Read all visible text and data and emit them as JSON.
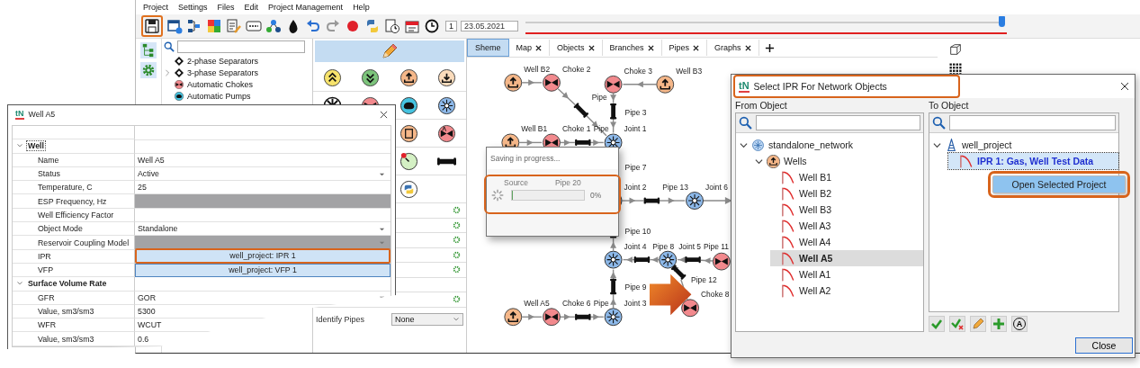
{
  "menu": [
    "Project",
    "Settings",
    "Files",
    "Edit",
    "Project Management",
    "Help"
  ],
  "toolbar": {
    "save_highlighted": true,
    "step": "1",
    "date": "23.05.2021",
    "timeline": {
      "level": 1
    }
  },
  "object_tree": {
    "items": [
      {
        "label": "2-phase Separators",
        "kind": "separator",
        "expandable": false
      },
      {
        "label": "3-phase Separators",
        "kind": "separator",
        "expandable": true
      },
      {
        "label": "Automatic Chokes",
        "kind": "choke",
        "expandable": false
      },
      {
        "label": "Automatic Pumps",
        "kind": "pump",
        "expandable": false
      }
    ]
  },
  "palette": {
    "identify_pipes": {
      "label": "Identify Pipes",
      "value": "None"
    }
  },
  "tabs": [
    {
      "label": "Sheme",
      "selected": true,
      "closable": false
    },
    {
      "label": "Map",
      "selected": false,
      "closable": true
    },
    {
      "label": "Objects",
      "selected": false,
      "closable": true
    },
    {
      "label": "Branches",
      "selected": false,
      "closable": true
    },
    {
      "label": "Pipes",
      "selected": false,
      "closable": true
    },
    {
      "label": "Graphs",
      "selected": false,
      "closable": true
    }
  ],
  "network": {
    "nodes": [
      {
        "kind": "well",
        "label": "Well B2"
      },
      {
        "kind": "choke",
        "label": "Choke 2"
      },
      {
        "kind": "choke",
        "label": "Choke 3"
      },
      {
        "kind": "well",
        "label": "Well B3"
      },
      {
        "kind": "pipe",
        "label": "Pipe"
      },
      {
        "kind": "pipe",
        "label": "Pipe 3"
      },
      {
        "kind": "well",
        "label": "Well B1"
      },
      {
        "kind": "choke",
        "label": "Choke 1"
      },
      {
        "kind": "pipe",
        "label": "Pipe"
      },
      {
        "kind": "joint",
        "label": "Joint 1"
      },
      {
        "kind": "pipe",
        "label": "Pipe 7"
      },
      {
        "kind": "joint",
        "label": "Joint 2"
      },
      {
        "kind": "pipe",
        "label": "Pipe 13"
      },
      {
        "kind": "joint",
        "label": "Joint 6"
      },
      {
        "kind": "pipe",
        "label": "Pipe 10"
      },
      {
        "kind": "joint",
        "label": "Joint 4"
      },
      {
        "kind": "pipe",
        "label": "Pipe 8"
      },
      {
        "kind": "joint",
        "label": "Joint 5"
      },
      {
        "kind": "pipe",
        "label": "Pipe 11"
      },
      {
        "kind": "choke"
      },
      {
        "kind": "pipe",
        "label": "Pipe 12"
      },
      {
        "kind": "pipe",
        "label": "Pipe 9"
      },
      {
        "kind": "well",
        "label": "Well A5"
      },
      {
        "kind": "choke",
        "label": "Choke 6"
      },
      {
        "kind": "pipe",
        "label": "Pipe"
      },
      {
        "kind": "joint",
        "label": "Joint 3"
      },
      {
        "kind": "choke",
        "label": "Choke 8"
      }
    ]
  },
  "saving_popup": {
    "title": "Saving in progress...",
    "source_label": "Source",
    "pipe_label": "Pipe 20",
    "percent": "0%",
    "level": 0,
    "highlighted": true
  },
  "well_window": {
    "logo": "tN",
    "title": "Well A5",
    "sections": [
      {
        "title": "Well",
        "expanded": true,
        "focused": true,
        "rows": [
          {
            "name": "Name",
            "value": "Well A5",
            "kind": "text",
            "highlighted": false
          },
          {
            "name": "Status",
            "value": "Active",
            "kind": "dropdown",
            "highlighted": false
          },
          {
            "name": "Temperature, C",
            "value": "25",
            "kind": "text",
            "highlighted": false
          },
          {
            "name": "ESP Frequency, Hz",
            "kind": "disabled",
            "highlighted": false
          },
          {
            "name": "Well Efficiency Factor",
            "kind": "text",
            "highlighted": false
          },
          {
            "name": "Object Mode",
            "value": "Standalone",
            "kind": "dropdown",
            "highlighted": false
          },
          {
            "name": "Reservoir Coupling Model",
            "kind": "disabled_dropdown",
            "highlighted": false
          },
          {
            "name": "IPR",
            "value": "well_project: IPR 1",
            "kind": "link",
            "highlighted": true
          },
          {
            "name": "VFP",
            "value": "well_project: VFP 1",
            "kind": "link",
            "highlighted": false
          }
        ]
      },
      {
        "title": "Surface Volume Rate",
        "expanded": true,
        "focused": false,
        "rows": [
          {
            "name": "GFR",
            "value": "GOR",
            "kind": "dropdown",
            "highlighted": false
          },
          {
            "name": "Value, sm3/sm3",
            "value": "5300",
            "kind": "text",
            "highlighted": false
          },
          {
            "name": "WFR",
            "value": "WCUT",
            "kind": "text",
            "highlighted": false
          },
          {
            "name": "Value, sm3/sm3",
            "value": "0.6",
            "kind": "text",
            "highlighted": false
          }
        ]
      }
    ]
  },
  "ipr_dialog": {
    "logo": "tN",
    "title": "Select IPR For Network Objects",
    "title_highlighted": true,
    "from_tree": {
      "label": "From Object",
      "focused": false,
      "nodes": [
        {
          "label": "standalone_network",
          "kind": "network",
          "expanded": true,
          "selected": false,
          "children": [
            {
              "label": "Wells",
              "kind": "group",
              "expanded": true,
              "selected": false,
              "children": [
                {
                  "label": "Well B1",
                  "kind": "curve",
                  "selected": false
                },
                {
                  "label": "Well B2",
                  "kind": "curve",
                  "selected": false
                },
                {
                  "label": "Well B3",
                  "kind": "curve",
                  "selected": false
                },
                {
                  "label": "Well A3",
                  "kind": "curve",
                  "selected": false
                },
                {
                  "label": "Well A4",
                  "kind": "curve",
                  "selected": false
                },
                {
                  "label": "Well A5",
                  "kind": "curve",
                  "selected": true
                },
                {
                  "label": "Well A1",
                  "kind": "curve",
                  "selected": false
                },
                {
                  "label": "Well A2",
                  "kind": "curve",
                  "selected": false
                }
              ]
            }
          ]
        }
      ]
    },
    "to_tree": {
      "label": "To Object",
      "focused": true,
      "nodes": [
        {
          "label": "well_project",
          "kind": "project",
          "expanded": true,
          "selected": false,
          "children": [
            {
              "label": "IPR 1: Gas, Well Test Data",
              "kind": "curve",
              "selected": true
            }
          ]
        }
      ]
    },
    "context_menu": [
      {
        "label": "Open Selected Project",
        "highlighted": true
      }
    ],
    "tool_buttons": [
      {
        "kind": "apply"
      },
      {
        "kind": "clear"
      },
      {
        "kind": "edit"
      },
      {
        "kind": "add"
      },
      {
        "kind": "auto",
        "label": "A"
      }
    ],
    "close_button": "Close"
  }
}
